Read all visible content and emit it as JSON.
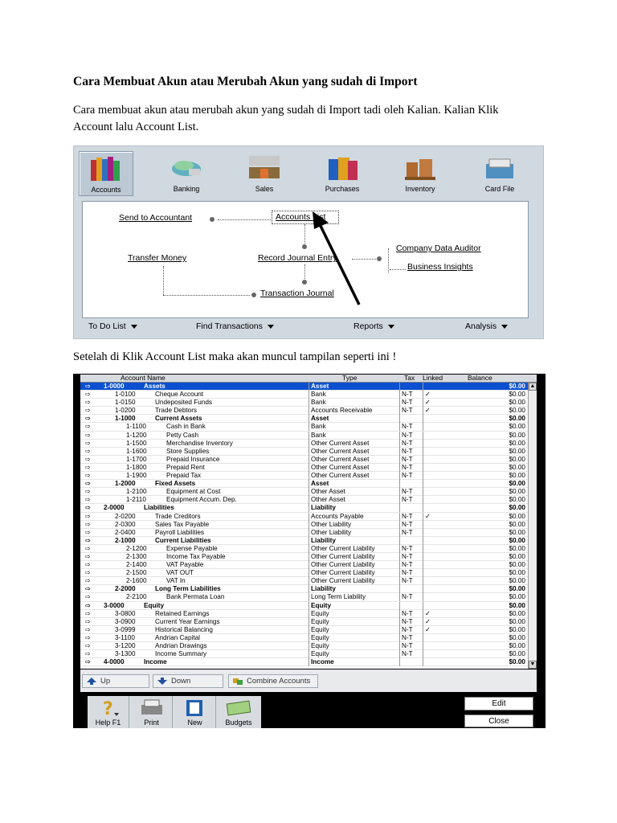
{
  "doc": {
    "heading": "Cara Membuat Akun atau Merubah Akun yang sudah di Import",
    "para1": "Cara membuat akun atau merubah akun yang sudah di Import tadi oleh Kalian.  Kalian Klik Account lalu Account List.",
    "para2": "Setelah di Klik Account List maka akan muncul tampilan seperti ini !"
  },
  "command_centre": {
    "tabs": [
      {
        "label": "Accounts",
        "icon": "accounts-books-icon",
        "active": true
      },
      {
        "label": "Banking",
        "icon": "banking-icon"
      },
      {
        "label": "Sales",
        "icon": "sales-icon"
      },
      {
        "label": "Purchases",
        "icon": "purchases-bags-icon"
      },
      {
        "label": "Inventory",
        "icon": "inventory-icon"
      },
      {
        "label": "Card File",
        "icon": "card-file-icon"
      }
    ],
    "links": {
      "send_to_accountant": "Send to Accountant",
      "accounts_list": "Accounts List",
      "transfer_money": "Transfer Money",
      "record_journal_entry": "Record Journal Entry",
      "company_data_auditor": "Company Data Auditor",
      "business_insights": "Business Insights",
      "transaction_journal": "Transaction Journal"
    },
    "bottom": {
      "todo": "To Do List",
      "find": "Find Transactions",
      "reports": "Reports",
      "analysis": "Analysis"
    }
  },
  "accounts_list": {
    "columns": {
      "name": "Account Name",
      "type": "Type",
      "tax": "Tax",
      "linked": "Linked",
      "balance": "Balance"
    },
    "rows": [
      {
        "level": 0,
        "hdr": true,
        "sel": true,
        "num": "1-0000",
        "name": "Assets",
        "type": "Asset",
        "tax": "",
        "linked": "",
        "bal": "$0.00"
      },
      {
        "level": 1,
        "num": "1-0100",
        "name": "Cheque Account",
        "type": "Bank",
        "tax": "N-T",
        "linked": "✓",
        "bal": "$0.00"
      },
      {
        "level": 1,
        "num": "1-0150",
        "name": "Undeposited Funds",
        "type": "Bank",
        "tax": "N-T",
        "linked": "✓",
        "bal": "$0.00"
      },
      {
        "level": 1,
        "num": "1-0200",
        "name": "Trade Debtors",
        "type": "Accounts Receivable",
        "tax": "N-T",
        "linked": "✓",
        "bal": "$0.00"
      },
      {
        "level": 1,
        "hdr": true,
        "num": "1-1000",
        "name": "Current Assets",
        "type": "Asset",
        "tax": "",
        "linked": "",
        "bal": "$0.00"
      },
      {
        "level": 2,
        "num": "1-1100",
        "name": "Cash in Bank",
        "type": "Bank",
        "tax": "N-T",
        "linked": "",
        "bal": "$0.00"
      },
      {
        "level": 2,
        "num": "1-1200",
        "name": "Petty Cash",
        "type": "Bank",
        "tax": "N-T",
        "linked": "",
        "bal": "$0.00"
      },
      {
        "level": 2,
        "num": "1-1500",
        "name": "Merchandise Inventory",
        "type": "Other Current Asset",
        "tax": "N-T",
        "linked": "",
        "bal": "$0.00"
      },
      {
        "level": 2,
        "num": "1-1600",
        "name": "Store Supplies",
        "type": "Other Current Asset",
        "tax": "N-T",
        "linked": "",
        "bal": "$0.00"
      },
      {
        "level": 2,
        "num": "1-1700",
        "name": "Prepaid Insurance",
        "type": "Other Current Asset",
        "tax": "N-T",
        "linked": "",
        "bal": "$0.00"
      },
      {
        "level": 2,
        "num": "1-1800",
        "name": "Prepaid Rent",
        "type": "Other Current Asset",
        "tax": "N-T",
        "linked": "",
        "bal": "$0.00"
      },
      {
        "level": 2,
        "num": "1-1900",
        "name": "Prepaid Tax",
        "type": "Other Current Asset",
        "tax": "N-T",
        "linked": "",
        "bal": "$0.00"
      },
      {
        "level": 1,
        "hdr": true,
        "num": "1-2000",
        "name": "Fixed Assets",
        "type": "Asset",
        "tax": "",
        "linked": "",
        "bal": "$0.00"
      },
      {
        "level": 2,
        "num": "1-2100",
        "name": "Equipment at Cost",
        "type": "Other Asset",
        "tax": "N-T",
        "linked": "",
        "bal": "$0.00"
      },
      {
        "level": 2,
        "num": "1-2110",
        "name": "Equipment Accum. Dep.",
        "type": "Other Asset",
        "tax": "N-T",
        "linked": "",
        "bal": "$0.00"
      },
      {
        "level": 0,
        "hdr": true,
        "num": "2-0000",
        "name": "Liabilities",
        "type": "Liability",
        "tax": "",
        "linked": "",
        "bal": "$0.00"
      },
      {
        "level": 1,
        "num": "2-0200",
        "name": "Trade Creditors",
        "type": "Accounts Payable",
        "tax": "N-T",
        "linked": "✓",
        "bal": "$0.00"
      },
      {
        "level": 1,
        "num": "2-0300",
        "name": "Sales Tax Payable",
        "type": "Other Liability",
        "tax": "N-T",
        "linked": "",
        "bal": "$0.00"
      },
      {
        "level": 1,
        "num": "2-0400",
        "name": "Payroll Liabilities",
        "type": "Other Liability",
        "tax": "N-T",
        "linked": "",
        "bal": "$0.00"
      },
      {
        "level": 1,
        "hdr": true,
        "num": "2-1000",
        "name": "Current Liabilities",
        "type": "Liability",
        "tax": "",
        "linked": "",
        "bal": "$0.00"
      },
      {
        "level": 2,
        "num": "2-1200",
        "name": "Expense Payable",
        "type": "Other Current Liability",
        "tax": "N-T",
        "linked": "",
        "bal": "$0.00"
      },
      {
        "level": 2,
        "num": "2-1300",
        "name": "Income Tax Payable",
        "type": "Other Current Liability",
        "tax": "N-T",
        "linked": "",
        "bal": "$0.00"
      },
      {
        "level": 2,
        "num": "2-1400",
        "name": "VAT Payable",
        "type": "Other Current Liability",
        "tax": "N-T",
        "linked": "",
        "bal": "$0.00"
      },
      {
        "level": 2,
        "num": "2-1500",
        "name": "VAT OUT",
        "type": "Other Current Liability",
        "tax": "N-T",
        "linked": "",
        "bal": "$0.00"
      },
      {
        "level": 2,
        "num": "2-1600",
        "name": "VAT In",
        "type": "Other Current Liability",
        "tax": "N-T",
        "linked": "",
        "bal": "$0.00"
      },
      {
        "level": 1,
        "hdr": true,
        "num": "2-2000",
        "name": "Long Term Liabilities",
        "type": "Liability",
        "tax": "",
        "linked": "",
        "bal": "$0.00"
      },
      {
        "level": 2,
        "num": "2-2100",
        "name": "Bank Permata Loan",
        "type": "Long Term Liability",
        "tax": "N-T",
        "linked": "",
        "bal": "$0.00"
      },
      {
        "level": 0,
        "hdr": true,
        "num": "3-0000",
        "name": "Equity",
        "type": "Equity",
        "tax": "",
        "linked": "",
        "bal": "$0.00"
      },
      {
        "level": 1,
        "num": "3-0800",
        "name": "Retained Earnings",
        "type": "Equity",
        "tax": "N-T",
        "linked": "✓",
        "bal": "$0.00"
      },
      {
        "level": 1,
        "num": "3-0900",
        "name": "Current Year Earnings",
        "type": "Equity",
        "tax": "N-T",
        "linked": "✓",
        "bal": "$0.00"
      },
      {
        "level": 1,
        "num": "3-0999",
        "name": "Historical Balancing",
        "type": "Equity",
        "tax": "N-T",
        "linked": "✓",
        "bal": "$0.00"
      },
      {
        "level": 1,
        "num": "3-1100",
        "name": "Andrian Capital",
        "type": "Equity",
        "tax": "N-T",
        "linked": "",
        "bal": "$0.00"
      },
      {
        "level": 1,
        "num": "3-1200",
        "name": "Andrian Drawings",
        "type": "Equity",
        "tax": "N-T",
        "linked": "",
        "bal": "$0.00"
      },
      {
        "level": 1,
        "num": "3-1300",
        "name": "Income Summary",
        "type": "Equity",
        "tax": "N-T",
        "linked": "",
        "bal": "$0.00"
      },
      {
        "level": 0,
        "hdr": true,
        "num": "4-0000",
        "name": "Income",
        "type": "Income",
        "tax": "",
        "linked": "",
        "bal": "$0.00"
      }
    ],
    "buttons": {
      "up": "Up",
      "down": "Down",
      "combine": "Combine Accounts"
    },
    "tools": [
      {
        "label": "Help F1",
        "icon": "help-icon"
      },
      {
        "label": "Print",
        "icon": "printer-icon"
      },
      {
        "label": "New",
        "icon": "new-icon"
      },
      {
        "label": "Budgets",
        "icon": "budgets-icon"
      }
    ],
    "edit": "Edit",
    "close": "Close"
  }
}
